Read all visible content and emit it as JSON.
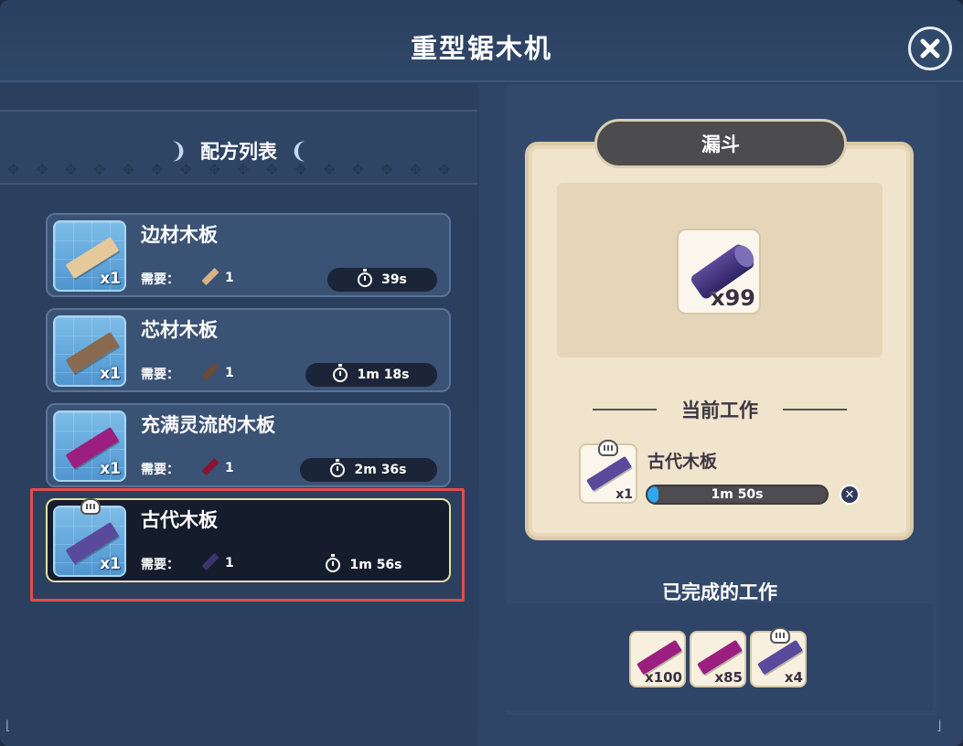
{
  "window": {
    "title": "重型锯木机",
    "close_icon": "close-icon"
  },
  "recipe_list": {
    "title": "配方列表",
    "need_label": "需要：",
    "recipes": [
      {
        "name": "边材木板",
        "qty": "x1",
        "need_count": "1",
        "time": "39s",
        "plank_color": "#e6c99a",
        "mat_color": "#d9b386",
        "selected": false
      },
      {
        "name": "芯材木板",
        "qty": "x1",
        "need_count": "1",
        "time": "1m 18s",
        "plank_color": "#8a6a4e",
        "mat_color": "#6c4a34",
        "selected": false
      },
      {
        "name": "充满灵流的木板",
        "qty": "x1",
        "need_count": "1",
        "time": "2m 36s",
        "plank_color": "#9c1f7f",
        "mat_color": "#8c1230",
        "selected": false
      },
      {
        "name": "古代木板",
        "qty": "x1",
        "need_count": "1",
        "time": "1m 56s",
        "plank_color": "#5a4a9c",
        "mat_color": "#3e3472",
        "selected": true
      }
    ]
  },
  "funnel": {
    "title": "漏斗",
    "item_qty": "x99",
    "current_work_label": "当前工作",
    "current_item_name": "古代木板",
    "current_item_qty": "x1",
    "progress_time": "1m 50s",
    "progress_fraction": 0.04
  },
  "completed": {
    "title": "已完成的工作",
    "items": [
      {
        "qty": "x100",
        "color": "#9c1f7f"
      },
      {
        "qty": "x85",
        "color": "#9c1f7f"
      },
      {
        "qty": "x4",
        "color": "#5a4a9c"
      }
    ]
  },
  "colors": {
    "accent_progress": "#2ea9ef",
    "highlight_border": "#e24c4c",
    "selected_border": "#e7dfa6"
  }
}
